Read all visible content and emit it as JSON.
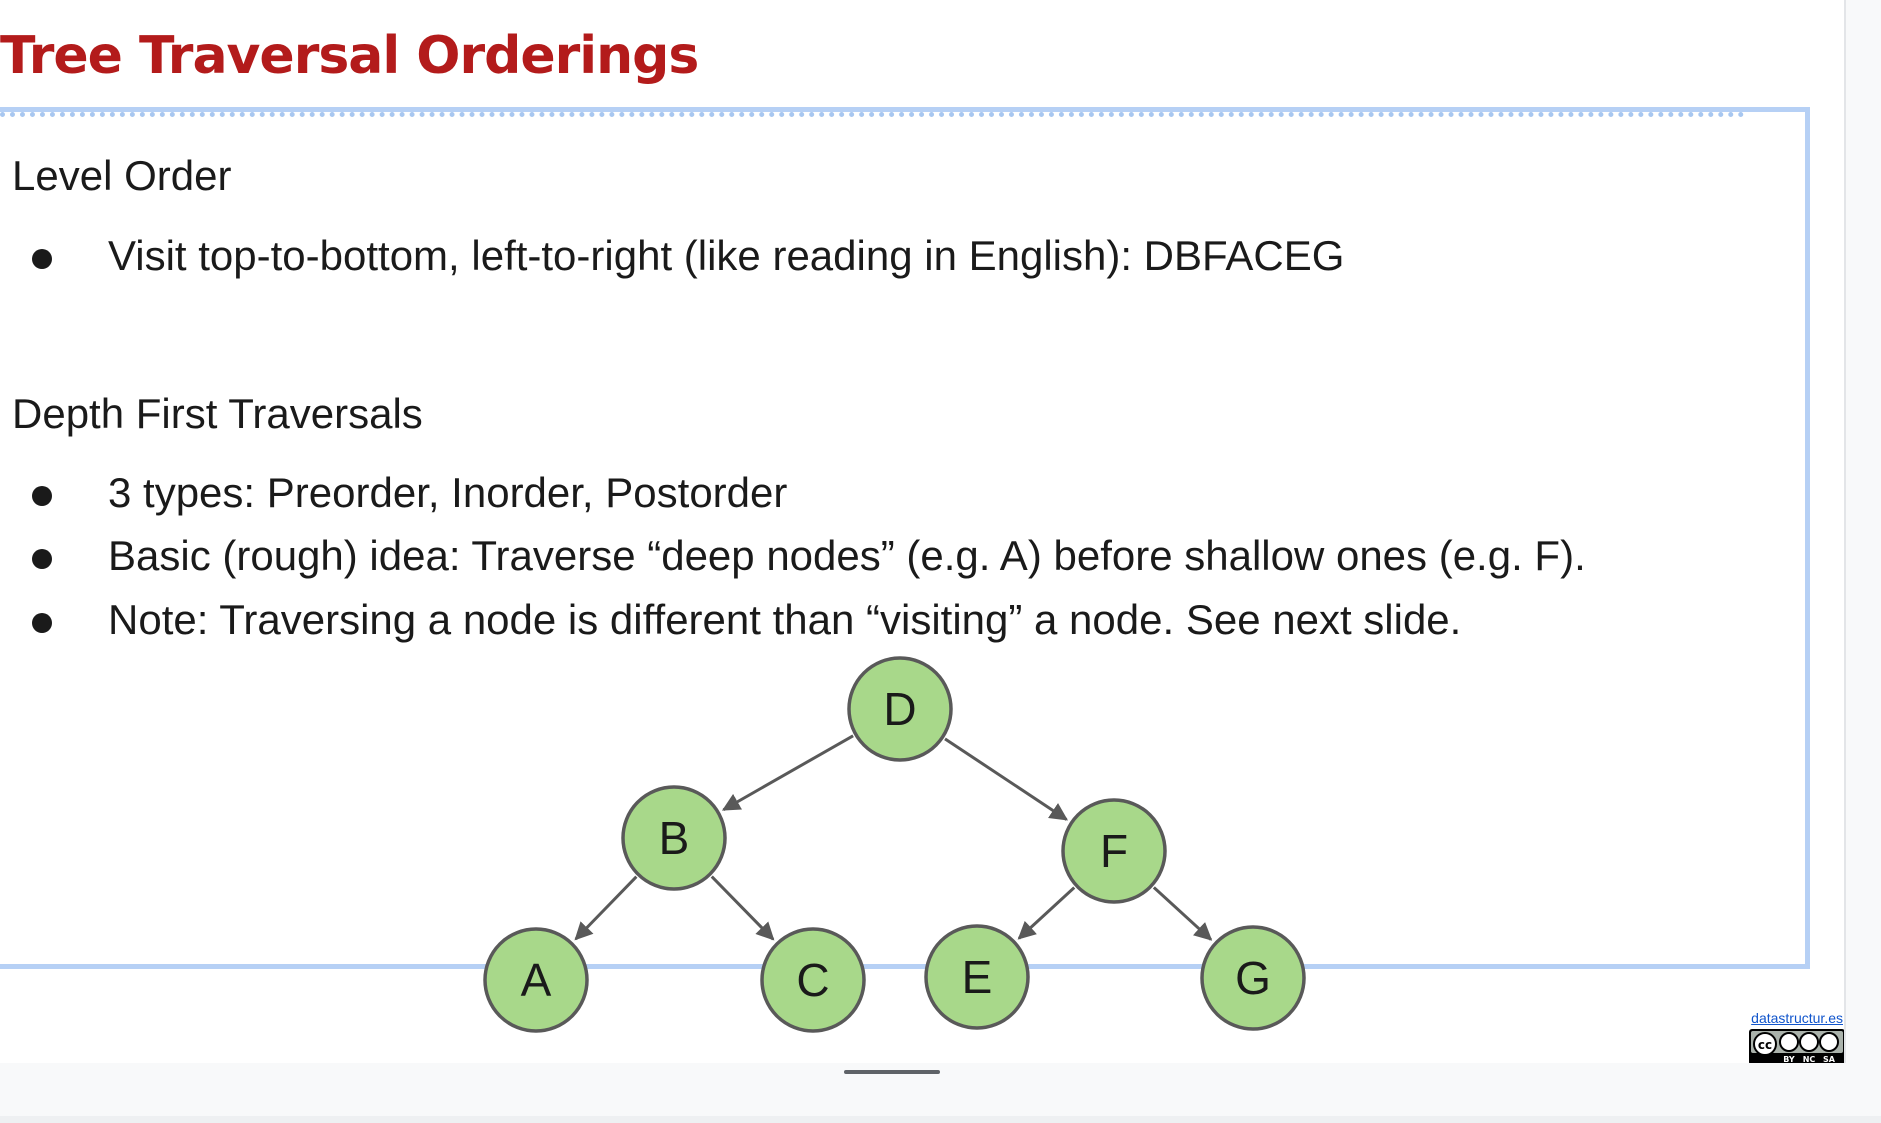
{
  "slide": {
    "title": "Tree Traversal Orderings",
    "sections": [
      {
        "heading": "Level Order",
        "bullets": [
          "Visit top-to-bottom, left-to-right (like reading in English): DBFACEG"
        ]
      },
      {
        "heading": "Depth First Traversals",
        "bullets": [
          "3 types: Preorder, Inorder, Postorder",
          "Basic (rough) idea: Traverse “deep nodes” (e.g. A) before shallow ones (e.g. F).",
          "Note: Traversing a node is different than “visiting” a node. See next slide."
        ]
      }
    ],
    "tree": {
      "node_color": "#a8d88a",
      "node_stroke": "#595959",
      "edge_color": "#595959",
      "nodes": [
        "D",
        "B",
        "F",
        "A",
        "C",
        "E",
        "G"
      ]
    }
  },
  "footer": {
    "site_link": "datastructur.es",
    "license_icon": "cc-by-nc-sa-icon",
    "license_labels": [
      "BY",
      "NC",
      "SA"
    ]
  },
  "colors": {
    "title": "#b31b1b",
    "frame": "#b6d0f5"
  }
}
